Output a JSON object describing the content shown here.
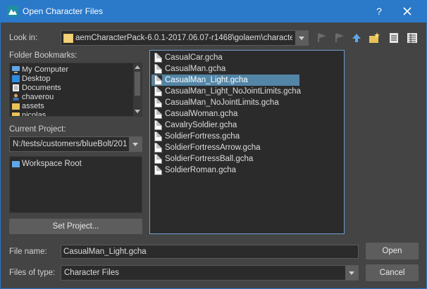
{
  "window": {
    "title": "Open Character Files",
    "help": "?"
  },
  "look_in": {
    "label": "Look in:",
    "path": "aemCharacterPack-6.0.1-2017.06.07-r1468\\golaem\\characters"
  },
  "toolbar": {
    "icons": [
      "back-icon",
      "forward-icon",
      "up-arrow-icon",
      "new-folder-icon",
      "list-view-icon",
      "detail-view-icon"
    ]
  },
  "bookmarks": {
    "label": "Folder Bookmarks:",
    "items": [
      {
        "label": "My Computer",
        "icon": "computer-icon"
      },
      {
        "label": "Desktop",
        "icon": "desktop-icon"
      },
      {
        "label": "Documents",
        "icon": "documents-icon"
      },
      {
        "label": "chaverou",
        "icon": "user-icon"
      },
      {
        "label": "assets",
        "icon": "folder-icon"
      },
      {
        "label": "nicolas",
        "icon": "folder-icon"
      }
    ]
  },
  "project": {
    "label": "Current Project:",
    "value": "N:/tests/customers/blueBolt/201",
    "workspace_item": "Workspace Root",
    "set_button": "Set Project..."
  },
  "files": [
    {
      "name": "CasualCar.gcha",
      "selected": false
    },
    {
      "name": "CasualMan.gcha",
      "selected": false
    },
    {
      "name": "CasualMan_Light.gcha",
      "selected": true
    },
    {
      "name": "CasualMan_Light_NoJointLimits.gcha",
      "selected": false
    },
    {
      "name": "CasualMan_NoJointLimits.gcha",
      "selected": false
    },
    {
      "name": "CasualWoman.gcha",
      "selected": false
    },
    {
      "name": "CavalrySoldier.gcha",
      "selected": false
    },
    {
      "name": "SoldierFortress.gcha",
      "selected": false
    },
    {
      "name": "SoldierFortressArrow.gcha",
      "selected": false
    },
    {
      "name": "SoldierFortressBall.gcha",
      "selected": false
    },
    {
      "name": "SoldierRoman.gcha",
      "selected": false
    }
  ],
  "file_name": {
    "label": "File name:",
    "value": "CasualMan_Light.gcha"
  },
  "file_type": {
    "label": "Files of type:",
    "value": "Character Files"
  },
  "buttons": {
    "open": "Open",
    "cancel": "Cancel"
  },
  "colors": {
    "titlebar": "#2b79c9",
    "background": "#444444",
    "selection": "#5285a6",
    "folder": "#e8c15a"
  }
}
